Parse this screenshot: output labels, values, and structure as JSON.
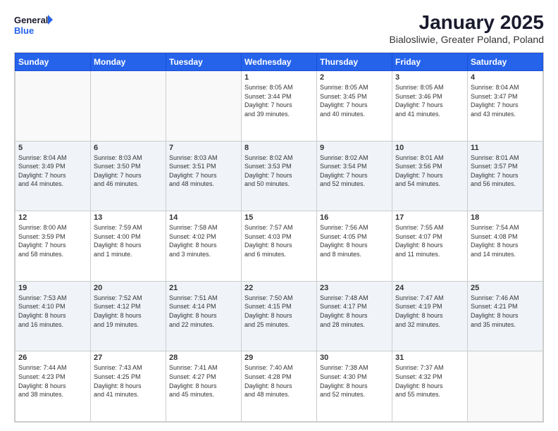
{
  "header": {
    "logo_general": "General",
    "logo_blue": "Blue",
    "title": "January 2025",
    "subtitle": "Bialosliwie, Greater Poland, Poland"
  },
  "days_of_week": [
    "Sunday",
    "Monday",
    "Tuesday",
    "Wednesday",
    "Thursday",
    "Friday",
    "Saturday"
  ],
  "weeks": [
    [
      {
        "day": "",
        "info": ""
      },
      {
        "day": "",
        "info": ""
      },
      {
        "day": "",
        "info": ""
      },
      {
        "day": "1",
        "info": "Sunrise: 8:05 AM\nSunset: 3:44 PM\nDaylight: 7 hours\nand 39 minutes."
      },
      {
        "day": "2",
        "info": "Sunrise: 8:05 AM\nSunset: 3:45 PM\nDaylight: 7 hours\nand 40 minutes."
      },
      {
        "day": "3",
        "info": "Sunrise: 8:05 AM\nSunset: 3:46 PM\nDaylight: 7 hours\nand 41 minutes."
      },
      {
        "day": "4",
        "info": "Sunrise: 8:04 AM\nSunset: 3:47 PM\nDaylight: 7 hours\nand 43 minutes."
      }
    ],
    [
      {
        "day": "5",
        "info": "Sunrise: 8:04 AM\nSunset: 3:49 PM\nDaylight: 7 hours\nand 44 minutes."
      },
      {
        "day": "6",
        "info": "Sunrise: 8:03 AM\nSunset: 3:50 PM\nDaylight: 7 hours\nand 46 minutes."
      },
      {
        "day": "7",
        "info": "Sunrise: 8:03 AM\nSunset: 3:51 PM\nDaylight: 7 hours\nand 48 minutes."
      },
      {
        "day": "8",
        "info": "Sunrise: 8:02 AM\nSunset: 3:53 PM\nDaylight: 7 hours\nand 50 minutes."
      },
      {
        "day": "9",
        "info": "Sunrise: 8:02 AM\nSunset: 3:54 PM\nDaylight: 7 hours\nand 52 minutes."
      },
      {
        "day": "10",
        "info": "Sunrise: 8:01 AM\nSunset: 3:56 PM\nDaylight: 7 hours\nand 54 minutes."
      },
      {
        "day": "11",
        "info": "Sunrise: 8:01 AM\nSunset: 3:57 PM\nDaylight: 7 hours\nand 56 minutes."
      }
    ],
    [
      {
        "day": "12",
        "info": "Sunrise: 8:00 AM\nSunset: 3:59 PM\nDaylight: 7 hours\nand 58 minutes."
      },
      {
        "day": "13",
        "info": "Sunrise: 7:59 AM\nSunset: 4:00 PM\nDaylight: 8 hours\nand 1 minute."
      },
      {
        "day": "14",
        "info": "Sunrise: 7:58 AM\nSunset: 4:02 PM\nDaylight: 8 hours\nand 3 minutes."
      },
      {
        "day": "15",
        "info": "Sunrise: 7:57 AM\nSunset: 4:03 PM\nDaylight: 8 hours\nand 6 minutes."
      },
      {
        "day": "16",
        "info": "Sunrise: 7:56 AM\nSunset: 4:05 PM\nDaylight: 8 hours\nand 8 minutes."
      },
      {
        "day": "17",
        "info": "Sunrise: 7:55 AM\nSunset: 4:07 PM\nDaylight: 8 hours\nand 11 minutes."
      },
      {
        "day": "18",
        "info": "Sunrise: 7:54 AM\nSunset: 4:08 PM\nDaylight: 8 hours\nand 14 minutes."
      }
    ],
    [
      {
        "day": "19",
        "info": "Sunrise: 7:53 AM\nSunset: 4:10 PM\nDaylight: 8 hours\nand 16 minutes."
      },
      {
        "day": "20",
        "info": "Sunrise: 7:52 AM\nSunset: 4:12 PM\nDaylight: 8 hours\nand 19 minutes."
      },
      {
        "day": "21",
        "info": "Sunrise: 7:51 AM\nSunset: 4:14 PM\nDaylight: 8 hours\nand 22 minutes."
      },
      {
        "day": "22",
        "info": "Sunrise: 7:50 AM\nSunset: 4:15 PM\nDaylight: 8 hours\nand 25 minutes."
      },
      {
        "day": "23",
        "info": "Sunrise: 7:48 AM\nSunset: 4:17 PM\nDaylight: 8 hours\nand 28 minutes."
      },
      {
        "day": "24",
        "info": "Sunrise: 7:47 AM\nSunset: 4:19 PM\nDaylight: 8 hours\nand 32 minutes."
      },
      {
        "day": "25",
        "info": "Sunrise: 7:46 AM\nSunset: 4:21 PM\nDaylight: 8 hours\nand 35 minutes."
      }
    ],
    [
      {
        "day": "26",
        "info": "Sunrise: 7:44 AM\nSunset: 4:23 PM\nDaylight: 8 hours\nand 38 minutes."
      },
      {
        "day": "27",
        "info": "Sunrise: 7:43 AM\nSunset: 4:25 PM\nDaylight: 8 hours\nand 41 minutes."
      },
      {
        "day": "28",
        "info": "Sunrise: 7:41 AM\nSunset: 4:27 PM\nDaylight: 8 hours\nand 45 minutes."
      },
      {
        "day": "29",
        "info": "Sunrise: 7:40 AM\nSunset: 4:28 PM\nDaylight: 8 hours\nand 48 minutes."
      },
      {
        "day": "30",
        "info": "Sunrise: 7:38 AM\nSunset: 4:30 PM\nDaylight: 8 hours\nand 52 minutes."
      },
      {
        "day": "31",
        "info": "Sunrise: 7:37 AM\nSunset: 4:32 PM\nDaylight: 8 hours\nand 55 minutes."
      },
      {
        "day": "",
        "info": ""
      }
    ]
  ]
}
